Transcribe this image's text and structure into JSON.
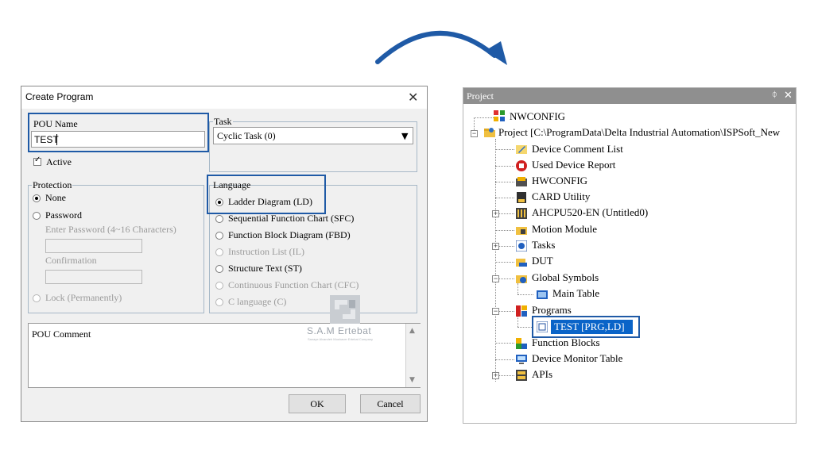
{
  "dialog": {
    "title": "Create Program",
    "close_glyph": "✕",
    "pou_name": {
      "label": "POU Name",
      "value": "TEST"
    },
    "active": {
      "label": "Active",
      "checked": true
    },
    "protection": {
      "label": "Protection",
      "options": [
        "None",
        "Password"
      ],
      "password_hint": "Enter Password (4~16 Characters)",
      "confirmation_label": "Confirmation",
      "lock_label": "Lock (Permanently)"
    },
    "task": {
      "label": "Task",
      "selected": "Cyclic Task (0)"
    },
    "language": {
      "label": "Language",
      "options": [
        "Ladder Diagram (LD)",
        "Sequential Function Chart (SFC)",
        "Function Block Diagram (FBD)",
        "Instruction List (IL)",
        "Structure Text (ST)",
        "Continuous Function Chart (CFC)",
        "C language (C)"
      ]
    },
    "pou_comment": {
      "label": "POU Comment"
    },
    "ok_label": "OK",
    "cancel_label": "Cancel"
  },
  "watermark": {
    "text": "S.A.M Ertebat",
    "sub": "Sanaye Alvandeh Moshaver Ertebat Company"
  },
  "project_panel": {
    "title": "Project",
    "pin_glyph": "ᛰ",
    "close_glyph": "✕",
    "items": {
      "nwconfig_top": "NWCONFIG",
      "project": "Project [C:\\ProgramData\\Delta Industrial Automation\\ISPSoft_New",
      "device_comment_list": "Device Comment List",
      "used_device_report": "Used Device Report",
      "hwconfig": "HWCONFIG",
      "card_utility": "CARD Utility",
      "ahcpu": "AHCPU520-EN  (Untitled0)",
      "motion_module": "Motion Module",
      "tasks": "Tasks",
      "dut": "DUT",
      "global_symbols": "Global Symbols",
      "main_table": "Main Table",
      "programs": "Programs",
      "test_prg": "TEST [PRG,LD]",
      "function_blocks": "Function Blocks",
      "device_monitor_table": "Device Monitor Table",
      "apis": "APIs"
    }
  },
  "colors": {
    "highlight": "#1f5aa6",
    "arrow": "#1f5aa6",
    "selection": "#0a64c8"
  }
}
